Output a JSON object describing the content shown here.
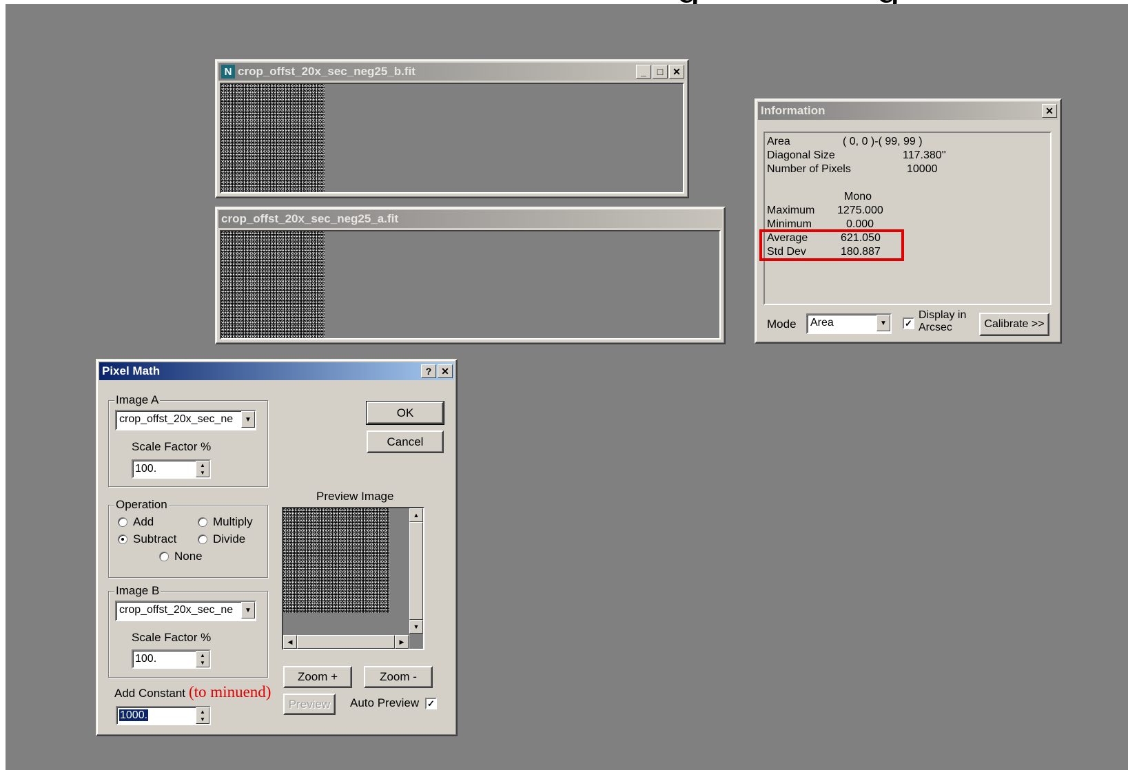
{
  "window_b": {
    "title": "crop_offst_20x_sec_neg25_b.fit"
  },
  "window_a": {
    "title": "crop_offst_20x_sec_neg25_a.fit"
  },
  "info": {
    "title": "Information",
    "area_label": "Area",
    "area_value": "( 0, 0 )-( 99, 99 )",
    "diag_label": "Diagonal Size",
    "diag_value": "117.380''",
    "npix_label": "Number of Pixels",
    "npix_value": "10000",
    "col_header": "Mono",
    "max_label": "Maximum",
    "max_value": "1275.000",
    "min_label": "Minimum",
    "min_value": "0.000",
    "avg_label": "Average",
    "avg_value": "621.050",
    "std_label": "Std Dev",
    "std_value": "180.887",
    "mode_label": "Mode",
    "mode_value": "Area",
    "display_line1": "Display in",
    "display_line2": "Arcsec",
    "calibrate_label": "Calibrate >>",
    "highlight_color": "#e00000"
  },
  "pixel_math": {
    "title": "Pixel Math",
    "image_a_label": "Image A",
    "image_a_value": "crop_offst_20x_sec_ne",
    "scale_a_label": "Scale Factor %",
    "scale_a_value": "100.",
    "operation_label": "Operation",
    "op_add": "Add",
    "op_multiply": "Multiply",
    "op_subtract": "Subtract",
    "op_divide": "Divide",
    "op_none": "None",
    "image_b_label": "Image B",
    "image_b_value": "crop_offst_20x_sec_ne",
    "scale_b_label": "Scale Factor %",
    "scale_b_value": "100.",
    "add_constant_label": "Add Constant",
    "annotation": "(to minuend)",
    "constant_value": "1000.",
    "ok_label": "OK",
    "cancel_label": "Cancel",
    "preview_image_label": "Preview Image",
    "zoom_in_label": "Zoom +",
    "zoom_out_label": "Zoom -",
    "preview_button_label": "Preview",
    "auto_preview_label": "Auto Preview",
    "annotation_color": "#e00000"
  }
}
